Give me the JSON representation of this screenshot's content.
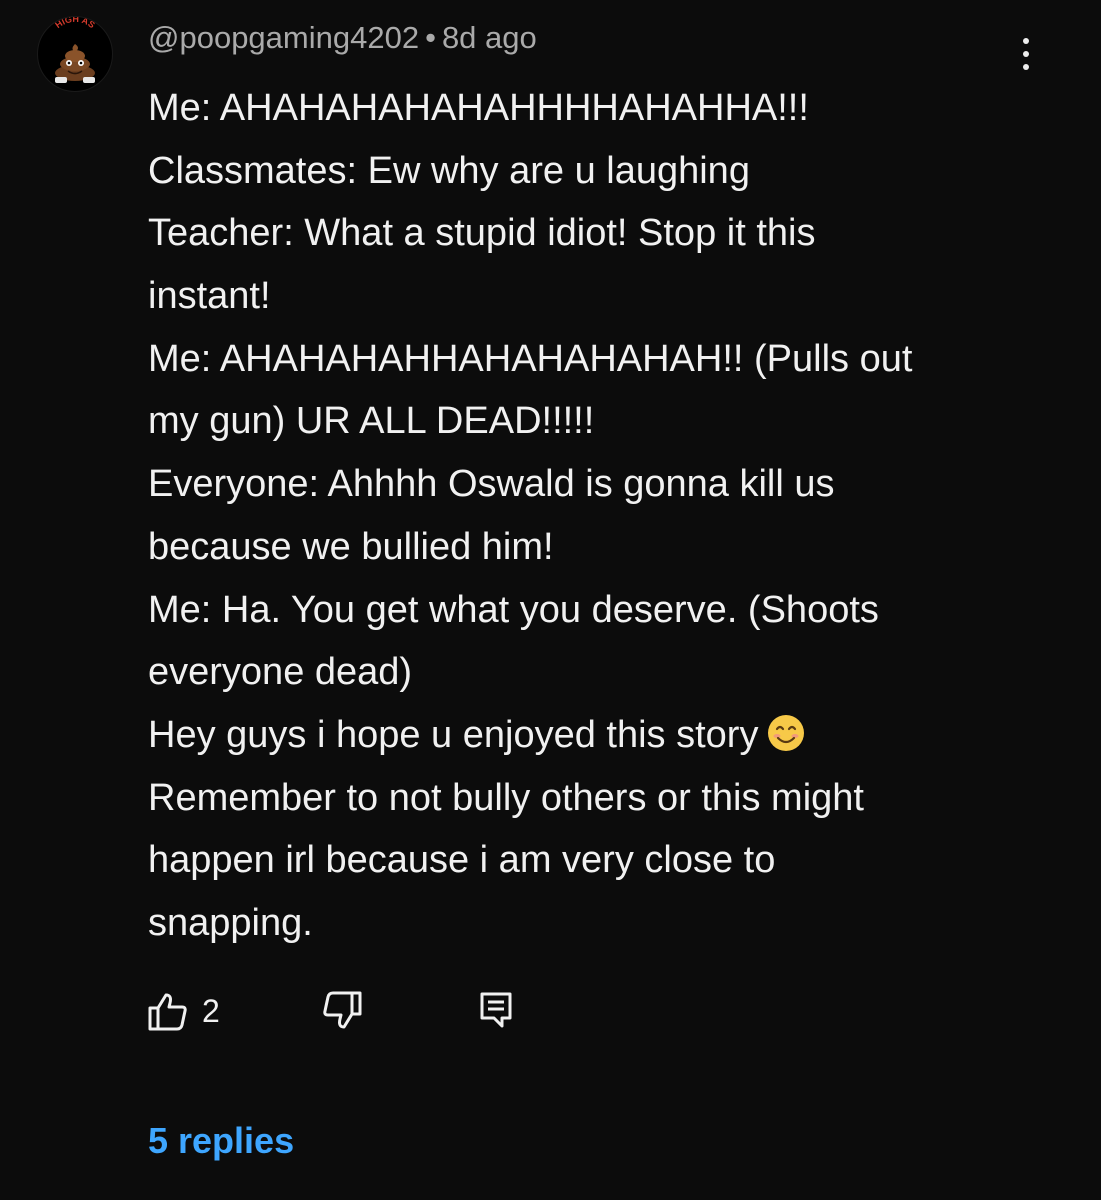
{
  "comment": {
    "author": "@poopgaming4202",
    "separator": "•",
    "timestamp": "8d ago",
    "avatar_text": "HIGH AS",
    "lines": [
      "Me: AHAHAHAHAHAHHHHAHAHHA!!!",
      "Classmates: Ew why are u laughing",
      "Teacher: What a stupid idiot! Stop it this",
      "instant!",
      "Me: AHAHAHAHHAHAHAHAHAH!! (Pulls out",
      "my gun) UR ALL DEAD!!!!!",
      "Everyone: Ahhhh Oswald is gonna kill us",
      "because we bullied him!",
      "Me: Ha. You get what you deserve. (Shoots",
      "everyone dead)",
      "Hey guys i hope u enjoyed this story",
      "Remember to not bully others or this might",
      "happen irl because i am very close to",
      "snapping."
    ],
    "emoji_icon": "smiling-face-emoji"
  },
  "actions": {
    "like_icon": "thumbs-up-icon",
    "like_count": "2",
    "dislike_icon": "thumbs-down-icon",
    "reply_icon": "reply-icon"
  },
  "replies_label": "5 replies",
  "colors": {
    "background": "#0c0c0c",
    "text": "#f1f1f1",
    "meta": "#aaaaaa",
    "link": "#3ea6ff"
  }
}
